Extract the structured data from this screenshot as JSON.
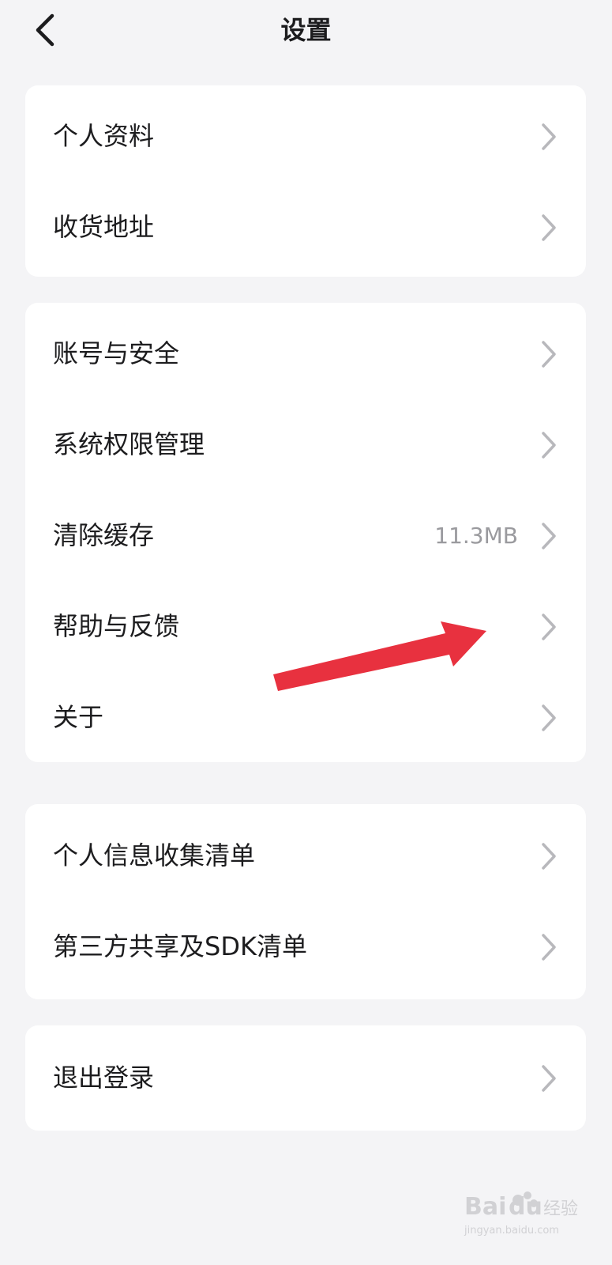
{
  "header": {
    "title": "设置"
  },
  "groups": [
    {
      "items": [
        {
          "label": "个人资料"
        },
        {
          "label": "收货地址"
        }
      ]
    },
    {
      "items": [
        {
          "label": "账号与安全"
        },
        {
          "label": "系统权限管理"
        },
        {
          "label": "清除缓存",
          "value": "11.3MB"
        },
        {
          "label": "帮助与反馈"
        },
        {
          "label": "关于"
        }
      ]
    },
    {
      "items": [
        {
          "label": "个人信息收集清单"
        },
        {
          "label": "第三方共享及SDK清单"
        }
      ]
    },
    {
      "items": [
        {
          "label": "退出登录"
        }
      ]
    }
  ],
  "annotation": {
    "color": "#e8313f"
  },
  "watermark": {
    "text": "Baidu经验",
    "subtext": "jingyan.baidu.com"
  },
  "colors": {
    "background": "#f4f4f6",
    "card": "#ffffff",
    "text": "#1c1c1e",
    "secondary_text": "#9a9a9e",
    "chevron": "#b8b8bc"
  },
  "icons": {
    "back": "chevron-left-icon",
    "row_arrow": "chevron-right-icon",
    "annotation": "red-arrow"
  }
}
